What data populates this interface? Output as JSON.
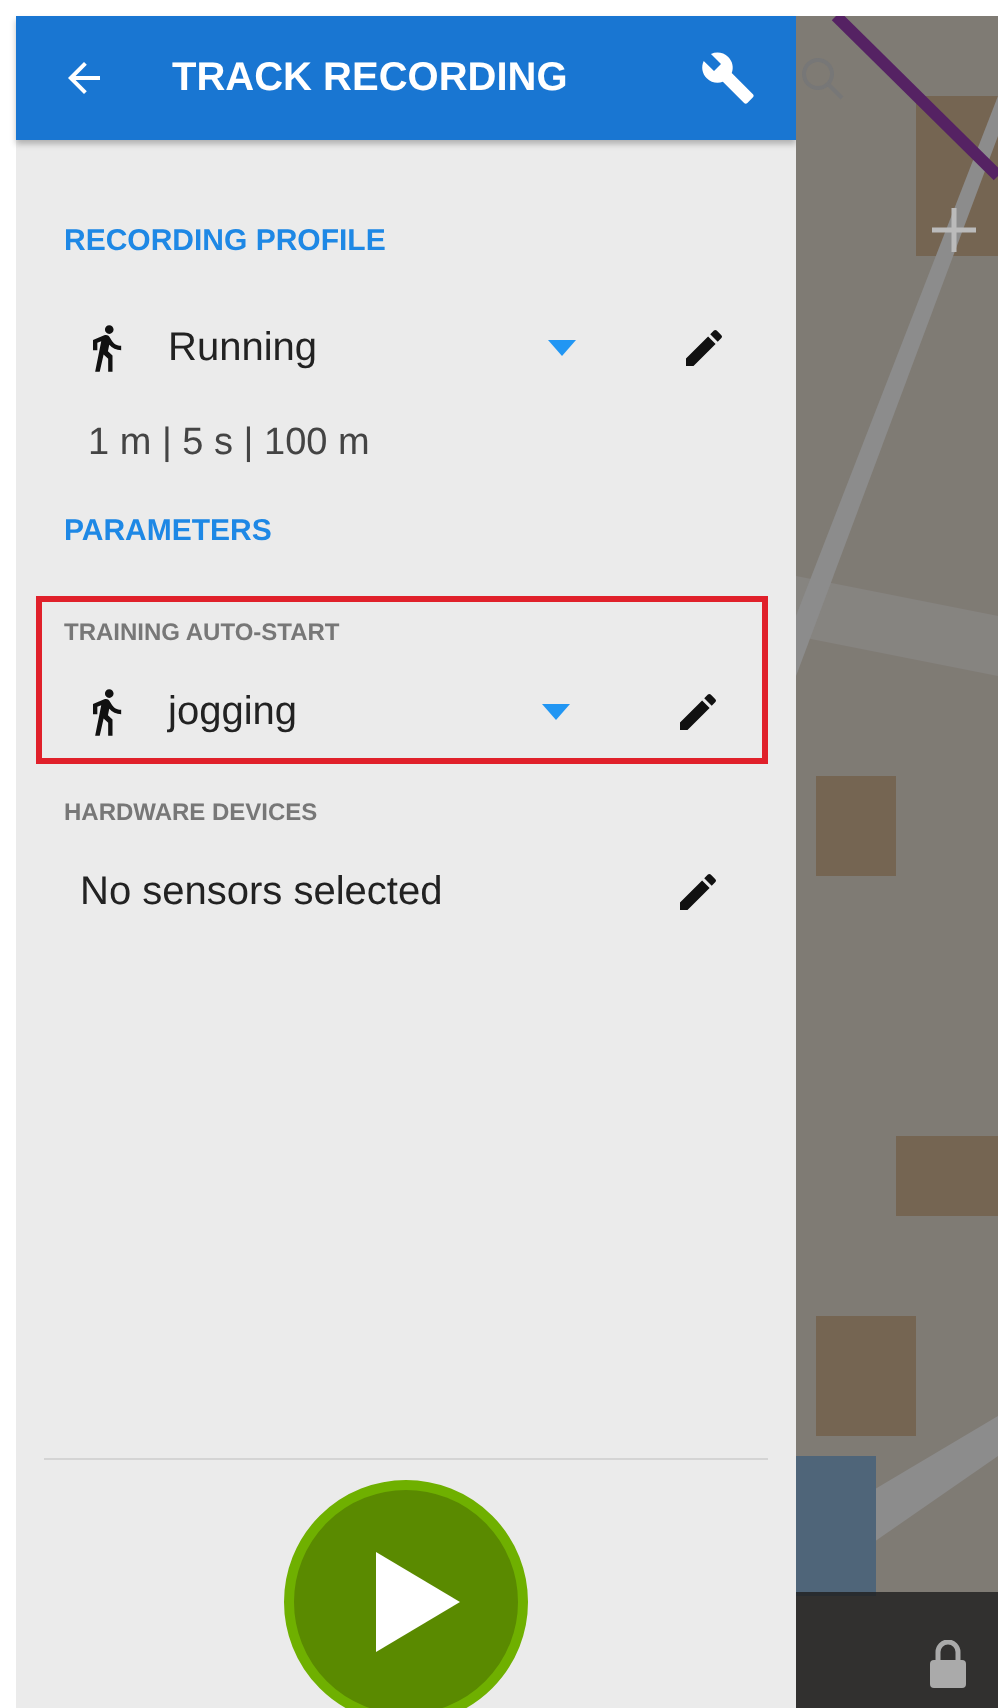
{
  "header": {
    "title": "TRACK RECORDING"
  },
  "recording_profile": {
    "heading": "RECORDING PROFILE",
    "value": "Running",
    "summary": "1 m | 5 s | 100 m"
  },
  "parameters": {
    "heading": "PARAMETERS",
    "sections": [
      {
        "label": "TRAINING AUTO-START",
        "kind": "dropdown",
        "value": "jogging",
        "highlighted": true
      },
      {
        "label": "HARDWARE DEVICES",
        "kind": "text",
        "value": "No sensors selected",
        "highlighted": false
      }
    ]
  }
}
